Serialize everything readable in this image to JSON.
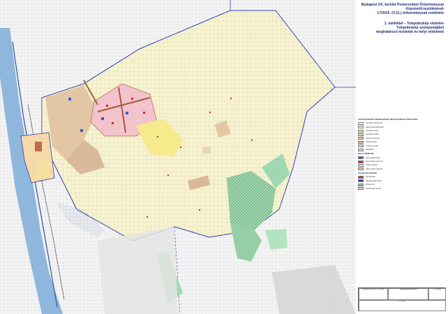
{
  "header": {
    "line1": "Budapest XX. kerület Pesterzsébet Önkormányzat",
    "line2": "Képviselő-testületének",
    "line3": "17/2015. (V.21.) önkormányzati rendelete",
    "subtitle1": "1. melléklet – Településkép védelme",
    "subtitle2": "Településkép szempontjából",
    "subtitle3": "meghatározó területek és helyi védelmek"
  },
  "legend": {
    "group1_title": "TELEPÜLÉSKÉPI SZEMPONTBÓL MEGHATÁROZÓ TERÜLETEK",
    "group1": [
      {
        "color": "#ffffff",
        "label": "Kertvárosi lakóterület"
      },
      {
        "color": "#f7f3c8",
        "label": "Nagyvárosi lakóterület"
      },
      {
        "color": "#f0e8a0",
        "label": "Kisvárosi terület"
      },
      {
        "color": "#e8d7b0",
        "label": "Lakótelep terület"
      },
      {
        "color": "#f2c9a0",
        "label": "Intézményi terület"
      },
      {
        "color": "#d9b99a",
        "label": "Vegyes terület"
      },
      {
        "color": "#f6d8e0",
        "label": "Történeti terület"
      },
      {
        "color": "#cfe8c8",
        "label": "Zöldfelület"
      }
    ],
    "group2_title": "HELYI VÉDELEM",
    "group2": [
      {
        "color": "#3b5bd9",
        "label": "Helyi védett épület"
      },
      {
        "color": "#d9242b",
        "label": "Helyi védett építmény"
      },
      {
        "color": "#cfe3f3",
        "label": "Védett utcakép"
      },
      {
        "color": "#f4c2c2",
        "label": "Helyi területi védelem"
      }
    ],
    "group3_title": "EGYÉB JELÖLÉSEK",
    "group3": [
      {
        "color": "#b23a3a",
        "label": "Kerülethatár"
      },
      {
        "color": "#4a3ab0",
        "label": "Közigazgatási határ"
      },
      {
        "color": "#7ec8a4",
        "label": "Erdőterület"
      },
      {
        "color": "#d0d0d0",
        "label": "Közlekedési terület"
      }
    ]
  },
  "titleblock": {
    "org": "Budapest Főváros XX. kerület",
    "title": "Településkép védelme",
    "sheet": "1. melléklet",
    "scale": "M 1:8000"
  },
  "colors": {
    "boundary": "#2d3bb5",
    "river": "#8fb6dc",
    "residential": "#f7f3d0",
    "green": "#9fd8b0",
    "gray": "#dedede",
    "orange": "#e9c7a6",
    "pink": "#f2c3cc",
    "yellow": "#f6ea8c",
    "historic": "#a55a3a"
  }
}
